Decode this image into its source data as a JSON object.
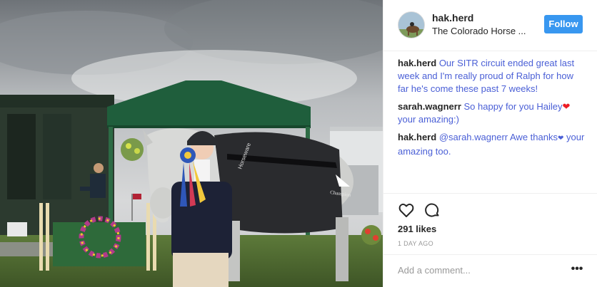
{
  "post": {
    "photo_icon": "post-photo",
    "username": "hak.herd",
    "location": "The Colorado Horse ...",
    "follow_label": "Follow"
  },
  "comments": [
    {
      "user": "hak.herd",
      "text": "Our SITR circuit ended great last week and I'm really proud of Ralph for how far he's come these past 7 weeks!"
    },
    {
      "user": "sarah.wagnerr",
      "text": "So happy for you Hailey",
      "emoji": "❤",
      "text2": "your amazing:)"
    },
    {
      "user": "hak.herd",
      "text": "@sarah.wagnerr Awe thanks",
      "emoji": "❤",
      "text2": "your amazing too."
    }
  ],
  "actions": {
    "like_icon": "heart-icon",
    "comment_icon": "comment-icon",
    "likes": "291 likes",
    "age": "1 DAY AGO"
  },
  "composer": {
    "placeholder": "Add a comment...",
    "more_label": "•••"
  },
  "photo_text": {
    "blanket_brand": "Horseware",
    "blanket_text": "Champion"
  },
  "colors": {
    "follow_bg": "#3897f0",
    "link": "#4a5fd6",
    "tent": "#1f5e3c"
  }
}
